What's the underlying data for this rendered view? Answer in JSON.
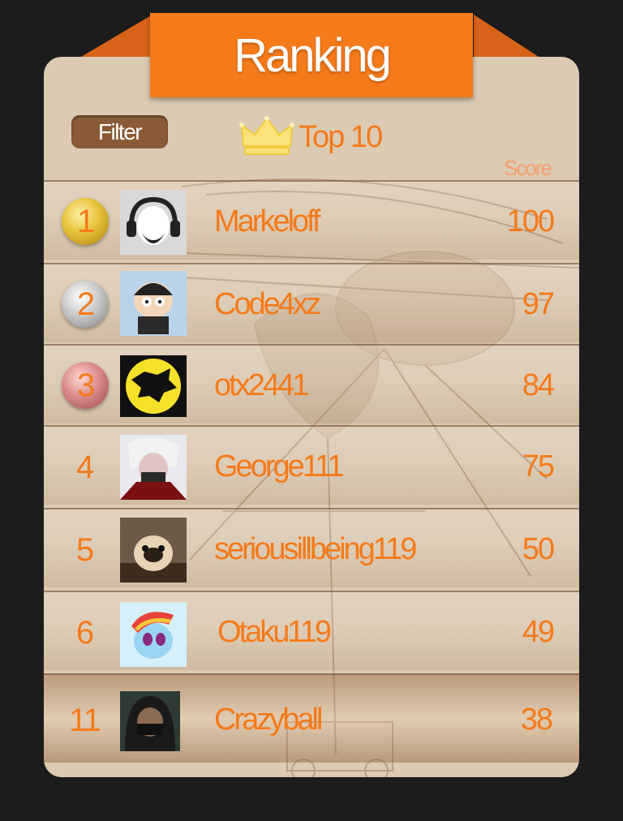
{
  "header": {
    "title": "Ranking"
  },
  "toolbar": {
    "filter_label": "Filter",
    "top_label": "Top 10",
    "crown_icon": "crown-icon"
  },
  "table": {
    "score_header": "Score",
    "rows": [
      {
        "rank": "1",
        "name": "Markeloff",
        "score": "100",
        "medal": "gold",
        "avatar": "headphones-avatar"
      },
      {
        "rank": "2",
        "name": "Code4xz",
        "score": "97",
        "medal": "silver",
        "avatar": "cartoon-kid-avatar"
      },
      {
        "rank": "3",
        "name": "otx2441",
        "score": "84",
        "medal": "bronze",
        "avatar": "wolf-logo-avatar"
      },
      {
        "rank": "4",
        "name": "George111",
        "score": "75",
        "medal": "",
        "avatar": "anime-mask-avatar"
      },
      {
        "rank": "5",
        "name": "seriousillbeing119",
        "score": "50",
        "medal": "",
        "avatar": "pug-avatar"
      },
      {
        "rank": "6",
        "name": "Otaku119",
        "score": "49",
        "medal": "",
        "avatar": "pony-avatar"
      },
      {
        "rank": "11",
        "name": "Crazyball",
        "score": "38",
        "medal": "",
        "avatar": "hooded-avatar"
      }
    ]
  },
  "colors": {
    "accent": "#f57a1a",
    "panel": "#dccab3",
    "background": "#1c1c1c",
    "filter_button": "#8a5a36"
  }
}
